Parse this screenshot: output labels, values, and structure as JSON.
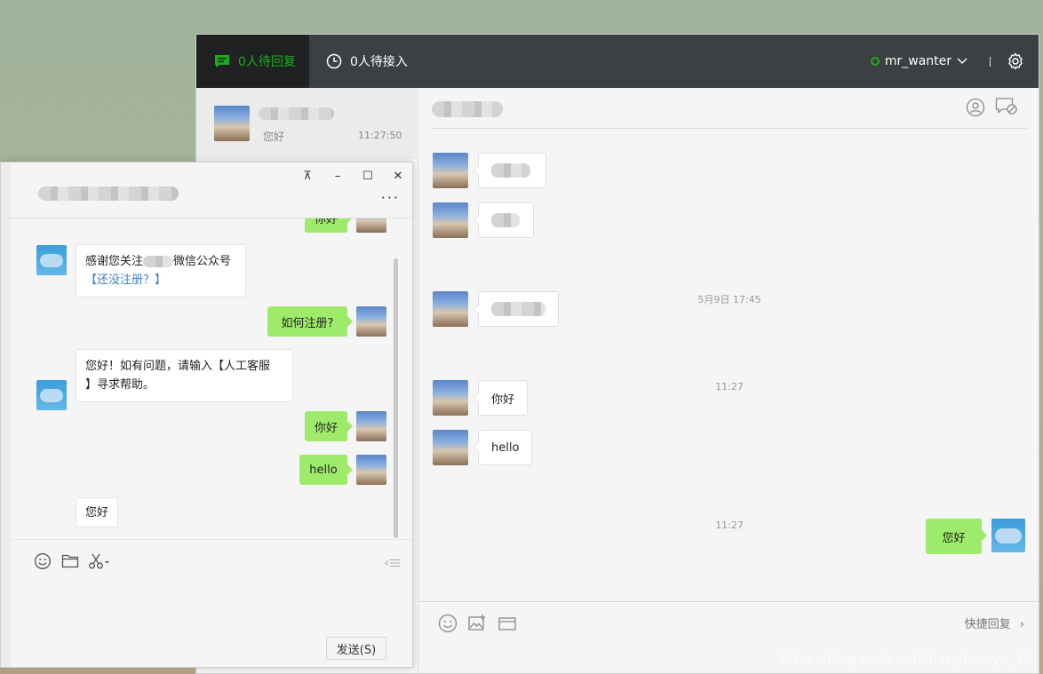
{
  "service_app": {
    "tabs": [
      {
        "label": "0人待回复",
        "icon": "chat-icon"
      },
      {
        "label": "0人待接入",
        "icon": "clock-icon"
      }
    ],
    "agent": {
      "name": "mr_wanter",
      "status": "online"
    },
    "conversation_list": [
      {
        "preview": "您好",
        "time": "11:27:50"
      }
    ],
    "chat": {
      "timestamps": [
        "5月9日 17:45",
        "11:27",
        "11:27"
      ],
      "messages": [
        {
          "side": "left",
          "text": "你好"
        },
        {
          "side": "left",
          "text": "hello"
        },
        {
          "side": "right",
          "text": "您好"
        }
      ],
      "quick_reply": "快捷回复"
    },
    "watermark": "https://blog.csdn.net/zhanghuaiyu_35"
  },
  "wechat_window": {
    "controls": {
      "pin": "⊼",
      "minimize": "–",
      "maximize": "☐",
      "close": "✕"
    },
    "more": "···",
    "messages": [
      {
        "side": "right",
        "text": "你好"
      },
      {
        "side": "left",
        "line1_before": "感谢您关注",
        "line1_after": "微信公众号",
        "link": "【还没注册？】"
      },
      {
        "side": "right",
        "text": "如何注册?"
      },
      {
        "side": "left",
        "line1": "您好！如有问题，请输入【人工客服",
        "line2": "】寻求帮助。"
      },
      {
        "side": "right",
        "text": "你好"
      },
      {
        "side": "right",
        "text": "hello"
      },
      {
        "side": "left",
        "text": "您好"
      }
    ],
    "send_button": "发送(S)"
  },
  "colors": {
    "accent_green": "#1aad19",
    "bubble_green": "#9eea6a",
    "topbar": "#3c4043",
    "link_blue": "#3b7fd0"
  }
}
